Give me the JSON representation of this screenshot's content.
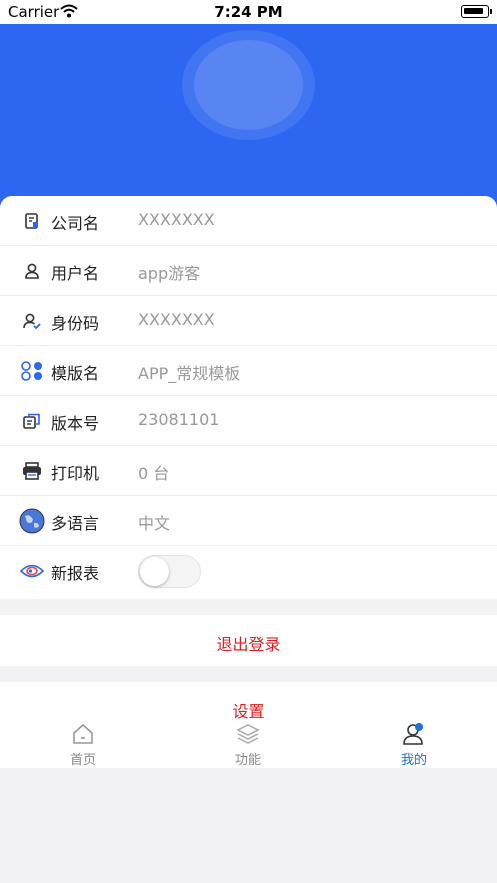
{
  "status_bar": {
    "carrier": "Carrier",
    "time": "7:24 PM"
  },
  "profile_rows": [
    {
      "label": "公司名",
      "value": "XXXXXXX",
      "icon": "document-icon"
    },
    {
      "label": "用户名",
      "value": "app游客",
      "icon": "user-icon"
    },
    {
      "label": "身份码",
      "value": "XXXXXXX",
      "icon": "user-verified-icon"
    },
    {
      "label": "模版名",
      "value": "APP_常规模板",
      "icon": "template-grid-icon"
    },
    {
      "label": "版本号",
      "value": "23081101",
      "icon": "version-copy-icon"
    },
    {
      "label": "打印机",
      "value": "0 台",
      "icon": "printer-icon"
    },
    {
      "label": "多语言",
      "value": "中文",
      "icon": "globe-icon"
    },
    {
      "label": "新报表",
      "value": "",
      "icon": "eye-icon",
      "toggle_on": false
    }
  ],
  "logout_label": "退出登录",
  "settings_label": "设置",
  "tabs": [
    {
      "label": "首页",
      "icon": "home-icon",
      "active": false
    },
    {
      "label": "功能",
      "icon": "layers-icon",
      "active": false
    },
    {
      "label": "我的",
      "icon": "profile-icon",
      "active": true
    }
  ],
  "colors": {
    "header_blue": "#2d66f1",
    "accent_red": "#e02020",
    "tab_active": "#1e6fe0"
  }
}
